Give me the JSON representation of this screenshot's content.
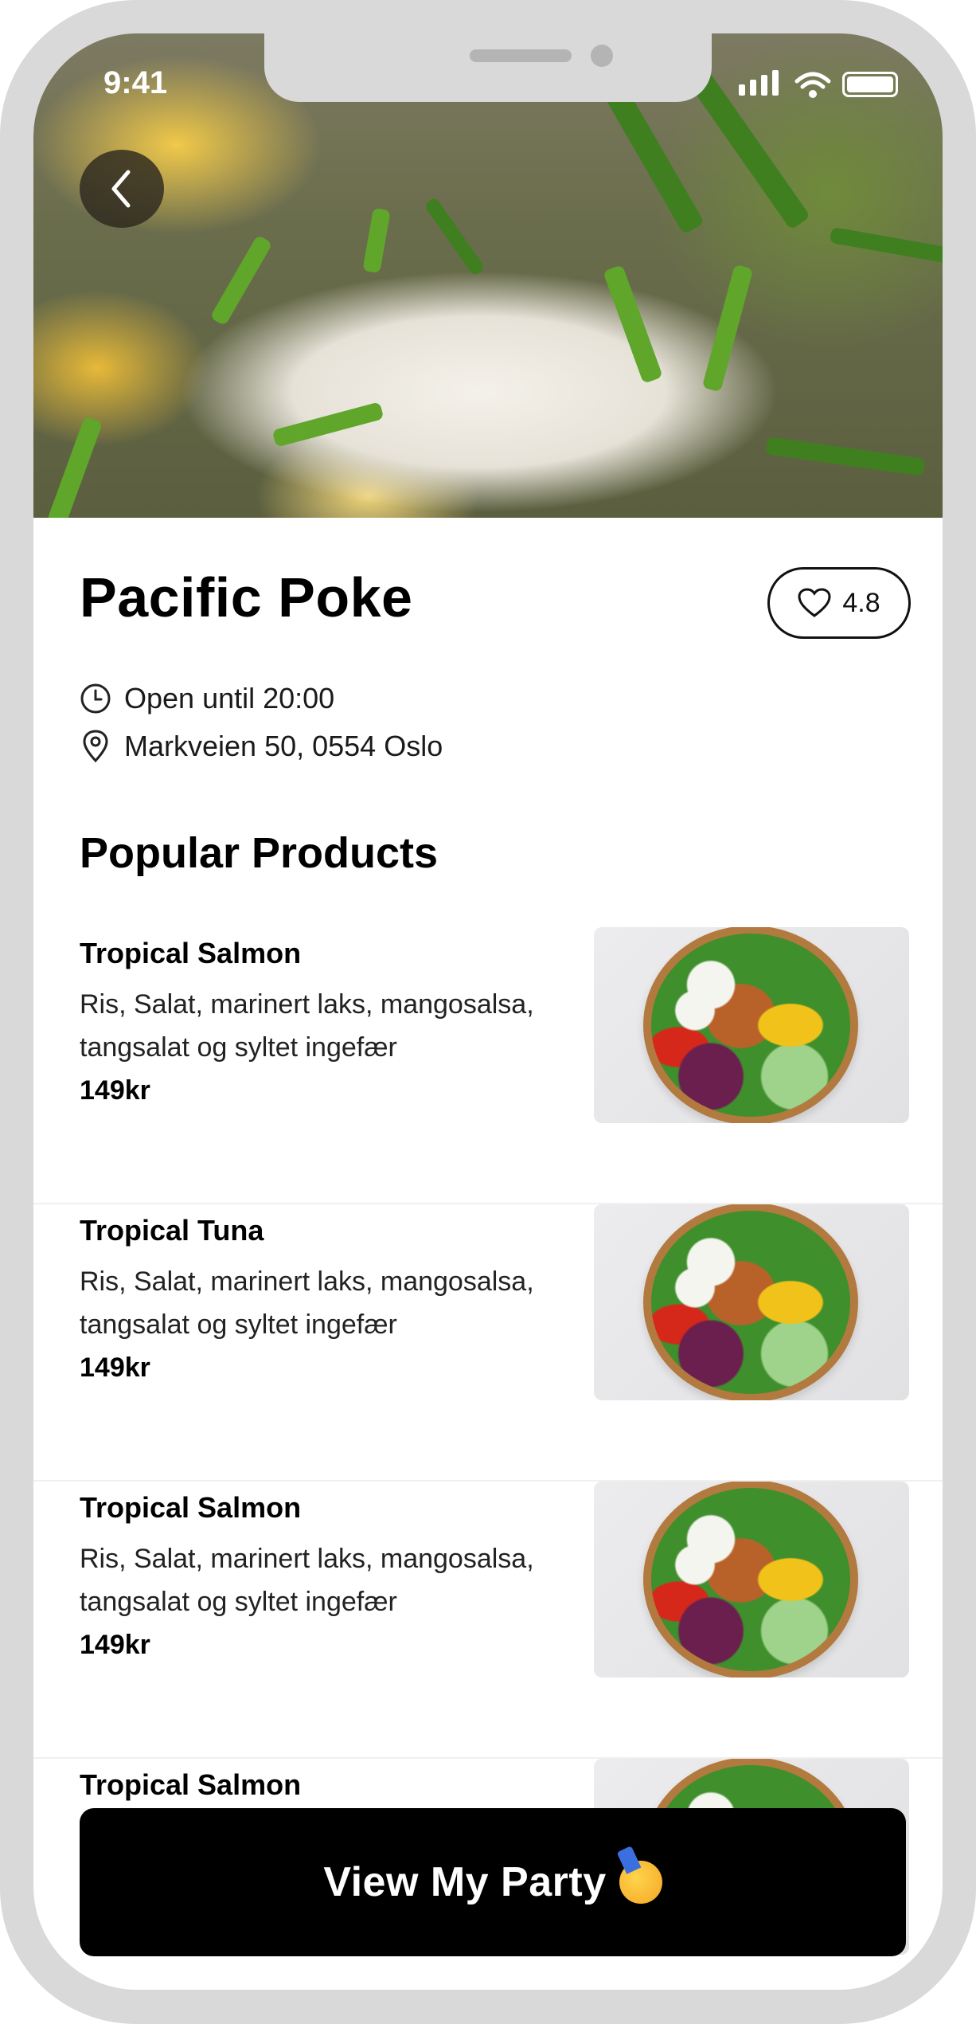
{
  "status_bar": {
    "time": "9:41"
  },
  "restaurant": {
    "name": "Pacific Poke",
    "rating": "4.8",
    "hours": "Open until 20:00",
    "address": "Markveien 50, 0554 Oslo"
  },
  "section_title": "Popular Products",
  "products": [
    {
      "name": "Tropical Salmon",
      "desc": "Ris, Salat, marinert laks, mangosalsa, tangsalat og syltet ingefær",
      "price": "149kr"
    },
    {
      "name": "Tropical Tuna",
      "desc": "Ris, Salat, marinert laks, mangosalsa, tangsalat og syltet ingefær",
      "price": "149kr"
    },
    {
      "name": "Tropical Salmon",
      "desc": "Ris, Salat, marinert laks, mangosalsa, tangsalat og syltet ingefær",
      "price": "149kr"
    },
    {
      "name": "Tropical Salmon",
      "desc": "",
      "price": ""
    }
  ],
  "cta": {
    "label": "View My Party",
    "emoji_icon": "partying-face-icon"
  },
  "colors": {
    "button_bg": "#000000",
    "frame": "#d9d9d9",
    "text": "#000000"
  }
}
